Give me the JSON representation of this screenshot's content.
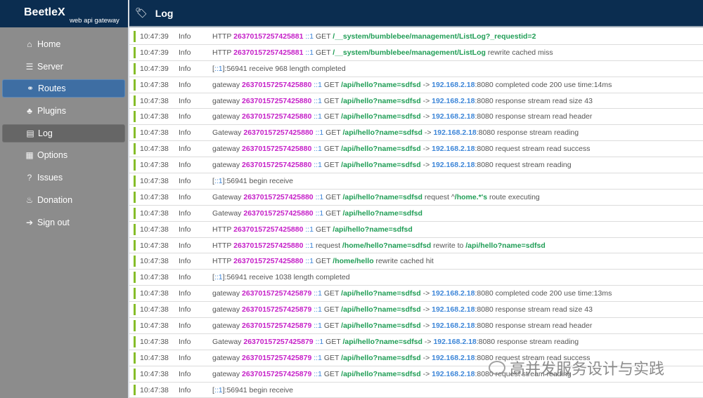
{
  "brand": {
    "name": "BeetleX",
    "subtitle": "web api gateway"
  },
  "sidebar": {
    "items": [
      {
        "label": "Home",
        "icon": "home-icon",
        "glyph": "⌂",
        "state": ""
      },
      {
        "label": "Server",
        "icon": "server-icon",
        "glyph": "☰",
        "state": ""
      },
      {
        "label": "Routes",
        "icon": "share-nodes-icon",
        "glyph": "⚭",
        "state": "active"
      },
      {
        "label": "Plugins",
        "icon": "cubes-icon",
        "glyph": "♣",
        "state": ""
      },
      {
        "label": "Log",
        "icon": "log-file-icon",
        "glyph": "▤",
        "state": "selected"
      },
      {
        "label": "Options",
        "icon": "options-file-icon",
        "glyph": "▦",
        "state": ""
      },
      {
        "label": "Issues",
        "icon": "question-circle-icon",
        "glyph": "?",
        "state": ""
      },
      {
        "label": "Donation",
        "icon": "donation-icon",
        "glyph": "♨",
        "state": ""
      },
      {
        "label": "Sign out",
        "icon": "sign-out-icon",
        "glyph": "➔",
        "state": ""
      }
    ]
  },
  "header": {
    "title": "Log",
    "icon": "tag-icon"
  },
  "colors": {
    "header_bg": "#0b2d50",
    "sidebar_bg": "#8c8c8c",
    "active_bg": "#3e6ea3",
    "selected_bg": "#666666",
    "level_bar": "#86bd29",
    "id": "#c51fc8",
    "host": "#3d86d8",
    "path": "#1f9d55"
  },
  "log": [
    {
      "time": "10:47:39",
      "level": "Info",
      "parts": [
        [
          "t",
          "HTTP "
        ],
        [
          "id",
          "26370157257425881"
        ],
        [
          "t",
          " "
        ],
        [
          "host",
          "::1"
        ],
        [
          "t",
          " GET "
        ],
        [
          "path",
          "/__system/bumblebee/management/ListLog?_requestid=2"
        ]
      ]
    },
    {
      "time": "10:47:39",
      "level": "Info",
      "parts": [
        [
          "t",
          "HTTP "
        ],
        [
          "id",
          "26370157257425881"
        ],
        [
          "t",
          " "
        ],
        [
          "host",
          "::1"
        ],
        [
          "t",
          " GET "
        ],
        [
          "path",
          "/__system/bumblebee/management/ListLog"
        ],
        [
          "t",
          " rewrite cached miss"
        ]
      ]
    },
    {
      "time": "10:47:39",
      "level": "Info",
      "parts": [
        [
          "t",
          "["
        ],
        [
          "host",
          "::1"
        ],
        [
          "t",
          "]:56941 receive 968 length completed"
        ]
      ]
    },
    {
      "time": "10:47:38",
      "level": "Info",
      "parts": [
        [
          "t",
          "gateway "
        ],
        [
          "id",
          "26370157257425880"
        ],
        [
          "t",
          " "
        ],
        [
          "host",
          "::1"
        ],
        [
          "t",
          " GET "
        ],
        [
          "path",
          "/api/hello?name=sdfsd"
        ],
        [
          "t",
          " -> "
        ],
        [
          "ip",
          "192.168.2.18"
        ],
        [
          "t",
          ":8080 completed code 200 use time:14ms"
        ]
      ]
    },
    {
      "time": "10:47:38",
      "level": "Info",
      "parts": [
        [
          "t",
          "gateway "
        ],
        [
          "id",
          "26370157257425880"
        ],
        [
          "t",
          " "
        ],
        [
          "host",
          "::1"
        ],
        [
          "t",
          " GET "
        ],
        [
          "path",
          "/api/hello?name=sdfsd"
        ],
        [
          "t",
          " -> "
        ],
        [
          "ip",
          "192.168.2.18"
        ],
        [
          "t",
          ":8080 response stream read size 43"
        ]
      ]
    },
    {
      "time": "10:47:38",
      "level": "Info",
      "parts": [
        [
          "t",
          "gateway "
        ],
        [
          "id",
          "26370157257425880"
        ],
        [
          "t",
          " "
        ],
        [
          "host",
          "::1"
        ],
        [
          "t",
          " GET "
        ],
        [
          "path",
          "/api/hello?name=sdfsd"
        ],
        [
          "t",
          " -> "
        ],
        [
          "ip",
          "192.168.2.18"
        ],
        [
          "t",
          ":8080 response stream read header"
        ]
      ]
    },
    {
      "time": "10:47:38",
      "level": "Info",
      "parts": [
        [
          "t",
          "Gateway "
        ],
        [
          "id",
          "26370157257425880"
        ],
        [
          "t",
          " "
        ],
        [
          "host",
          "::1"
        ],
        [
          "t",
          " GET "
        ],
        [
          "path",
          "/api/hello?name=sdfsd"
        ],
        [
          "t",
          " -> "
        ],
        [
          "ip",
          "192.168.2.18"
        ],
        [
          "t",
          ":8080 response stream reading"
        ]
      ]
    },
    {
      "time": "10:47:38",
      "level": "Info",
      "parts": [
        [
          "t",
          "gateway "
        ],
        [
          "id",
          "26370157257425880"
        ],
        [
          "t",
          " "
        ],
        [
          "host",
          "::1"
        ],
        [
          "t",
          " GET "
        ],
        [
          "path",
          "/api/hello?name=sdfsd"
        ],
        [
          "t",
          " -> "
        ],
        [
          "ip",
          "192.168.2.18"
        ],
        [
          "t",
          ":8080 request stream read success"
        ]
      ]
    },
    {
      "time": "10:47:38",
      "level": "Info",
      "parts": [
        [
          "t",
          "gateway "
        ],
        [
          "id",
          "26370157257425880"
        ],
        [
          "t",
          " "
        ],
        [
          "host",
          "::1"
        ],
        [
          "t",
          " GET "
        ],
        [
          "path",
          "/api/hello?name=sdfsd"
        ],
        [
          "t",
          " -> "
        ],
        [
          "ip",
          "192.168.2.18"
        ],
        [
          "t",
          ":8080 request stream reading"
        ]
      ]
    },
    {
      "time": "10:47:38",
      "level": "Info",
      "parts": [
        [
          "t",
          "["
        ],
        [
          "host",
          "::1"
        ],
        [
          "t",
          "]:56941 begin receive"
        ]
      ]
    },
    {
      "time": "10:47:38",
      "level": "Info",
      "parts": [
        [
          "t",
          "Gateway "
        ],
        [
          "id",
          "26370157257425880"
        ],
        [
          "t",
          " "
        ],
        [
          "host",
          "::1"
        ],
        [
          "t",
          " GET "
        ],
        [
          "path",
          "/api/hello?name=sdfsd"
        ],
        [
          "t",
          " request ^"
        ],
        [
          "path",
          "/home.*'s"
        ],
        [
          "t",
          " route executing"
        ]
      ]
    },
    {
      "time": "10:47:38",
      "level": "Info",
      "parts": [
        [
          "t",
          "Gateway "
        ],
        [
          "id",
          "26370157257425880"
        ],
        [
          "t",
          " "
        ],
        [
          "host",
          "::1"
        ],
        [
          "t",
          " GET "
        ],
        [
          "path",
          "/api/hello?name=sdfsd"
        ]
      ]
    },
    {
      "time": "10:47:38",
      "level": "Info",
      "parts": [
        [
          "t",
          "HTTP "
        ],
        [
          "id",
          "26370157257425880"
        ],
        [
          "t",
          " "
        ],
        [
          "host",
          "::1"
        ],
        [
          "t",
          " GET "
        ],
        [
          "path",
          "/api/hello?name=sdfsd"
        ]
      ]
    },
    {
      "time": "10:47:38",
      "level": "Info",
      "parts": [
        [
          "t",
          "HTTP "
        ],
        [
          "id",
          "26370157257425880"
        ],
        [
          "t",
          " "
        ],
        [
          "host",
          "::1"
        ],
        [
          "t",
          " request "
        ],
        [
          "path",
          "/home/hello?name=sdfsd"
        ],
        [
          "t",
          " rewrite to "
        ],
        [
          "path",
          "/api/hello?name=sdfsd"
        ]
      ]
    },
    {
      "time": "10:47:38",
      "level": "Info",
      "parts": [
        [
          "t",
          "HTTP "
        ],
        [
          "id",
          "26370157257425880"
        ],
        [
          "t",
          " "
        ],
        [
          "host",
          "::1"
        ],
        [
          "t",
          " GET "
        ],
        [
          "path",
          "/home/hello"
        ],
        [
          "t",
          " rewrite cached hit"
        ]
      ]
    },
    {
      "time": "10:47:38",
      "level": "Info",
      "parts": [
        [
          "t",
          "["
        ],
        [
          "host",
          "::1"
        ],
        [
          "t",
          "]:56941 receive 1038 length completed"
        ]
      ]
    },
    {
      "time": "10:47:38",
      "level": "Info",
      "parts": [
        [
          "t",
          "gateway "
        ],
        [
          "id",
          "26370157257425879"
        ],
        [
          "t",
          " "
        ],
        [
          "host",
          "::1"
        ],
        [
          "t",
          " GET "
        ],
        [
          "path",
          "/api/hello?name=sdfsd"
        ],
        [
          "t",
          " -> "
        ],
        [
          "ip",
          "192.168.2.18"
        ],
        [
          "t",
          ":8080 completed code 200 use time:13ms"
        ]
      ]
    },
    {
      "time": "10:47:38",
      "level": "Info",
      "parts": [
        [
          "t",
          "gateway "
        ],
        [
          "id",
          "26370157257425879"
        ],
        [
          "t",
          " "
        ],
        [
          "host",
          "::1"
        ],
        [
          "t",
          " GET "
        ],
        [
          "path",
          "/api/hello?name=sdfsd"
        ],
        [
          "t",
          " -> "
        ],
        [
          "ip",
          "192.168.2.18"
        ],
        [
          "t",
          ":8080 response stream read size 43"
        ]
      ]
    },
    {
      "time": "10:47:38",
      "level": "Info",
      "parts": [
        [
          "t",
          "gateway "
        ],
        [
          "id",
          "26370157257425879"
        ],
        [
          "t",
          " "
        ],
        [
          "host",
          "::1"
        ],
        [
          "t",
          " GET "
        ],
        [
          "path",
          "/api/hello?name=sdfsd"
        ],
        [
          "t",
          " -> "
        ],
        [
          "ip",
          "192.168.2.18"
        ],
        [
          "t",
          ":8080 response stream read header"
        ]
      ]
    },
    {
      "time": "10:47:38",
      "level": "Info",
      "parts": [
        [
          "t",
          "Gateway "
        ],
        [
          "id",
          "26370157257425879"
        ],
        [
          "t",
          " "
        ],
        [
          "host",
          "::1"
        ],
        [
          "t",
          " GET "
        ],
        [
          "path",
          "/api/hello?name=sdfsd"
        ],
        [
          "t",
          " -> "
        ],
        [
          "ip",
          "192.168.2.18"
        ],
        [
          "t",
          ":8080 response stream reading"
        ]
      ]
    },
    {
      "time": "10:47:38",
      "level": "Info",
      "parts": [
        [
          "t",
          "gateway "
        ],
        [
          "id",
          "26370157257425879"
        ],
        [
          "t",
          " "
        ],
        [
          "host",
          "::1"
        ],
        [
          "t",
          " GET "
        ],
        [
          "path",
          "/api/hello?name=sdfsd"
        ],
        [
          "t",
          " -> "
        ],
        [
          "ip",
          "192.168.2.18"
        ],
        [
          "t",
          ":8080 request stream read success"
        ]
      ]
    },
    {
      "time": "10:47:38",
      "level": "Info",
      "parts": [
        [
          "t",
          "gateway "
        ],
        [
          "id",
          "26370157257425879"
        ],
        [
          "t",
          " "
        ],
        [
          "host",
          "::1"
        ],
        [
          "t",
          " GET "
        ],
        [
          "path",
          "/api/hello?name=sdfsd"
        ],
        [
          "t",
          " -> "
        ],
        [
          "ip",
          "192.168.2.18"
        ],
        [
          "t",
          ":8080 request stream reading"
        ]
      ]
    },
    {
      "time": "10:47:38",
      "level": "Info",
      "parts": [
        [
          "t",
          "["
        ],
        [
          "host",
          "::1"
        ],
        [
          "t",
          "]:56941 begin receive"
        ]
      ]
    }
  ],
  "watermark": {
    "text": "高并发服务设计与实践",
    "icon": "wechat-icon"
  }
}
